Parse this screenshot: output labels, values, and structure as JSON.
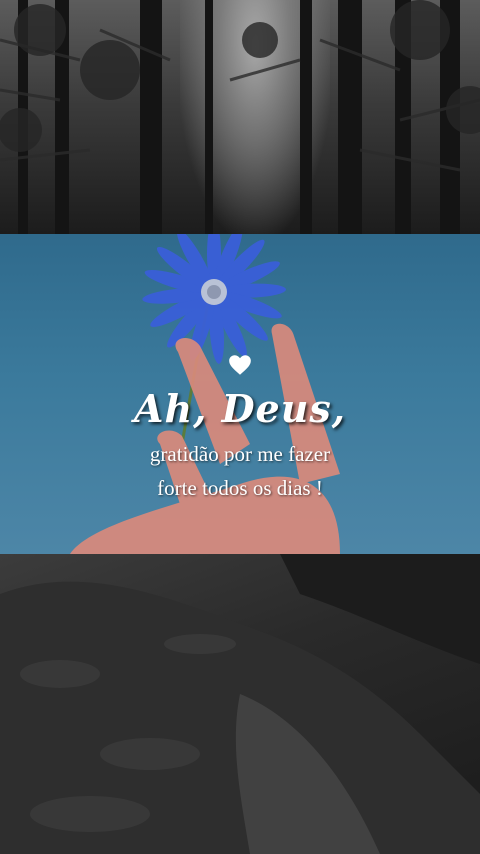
{
  "caption": {
    "title": "Ah, Deus,",
    "line1": "gratidão por me fazer",
    "line2": "forte todos os dias !"
  },
  "colors": {
    "sky_blue": "#3b7a9c",
    "flower_blue": "#3a5fd8",
    "skin": "#d98a7c"
  },
  "icons": [
    "heart-icon"
  ]
}
